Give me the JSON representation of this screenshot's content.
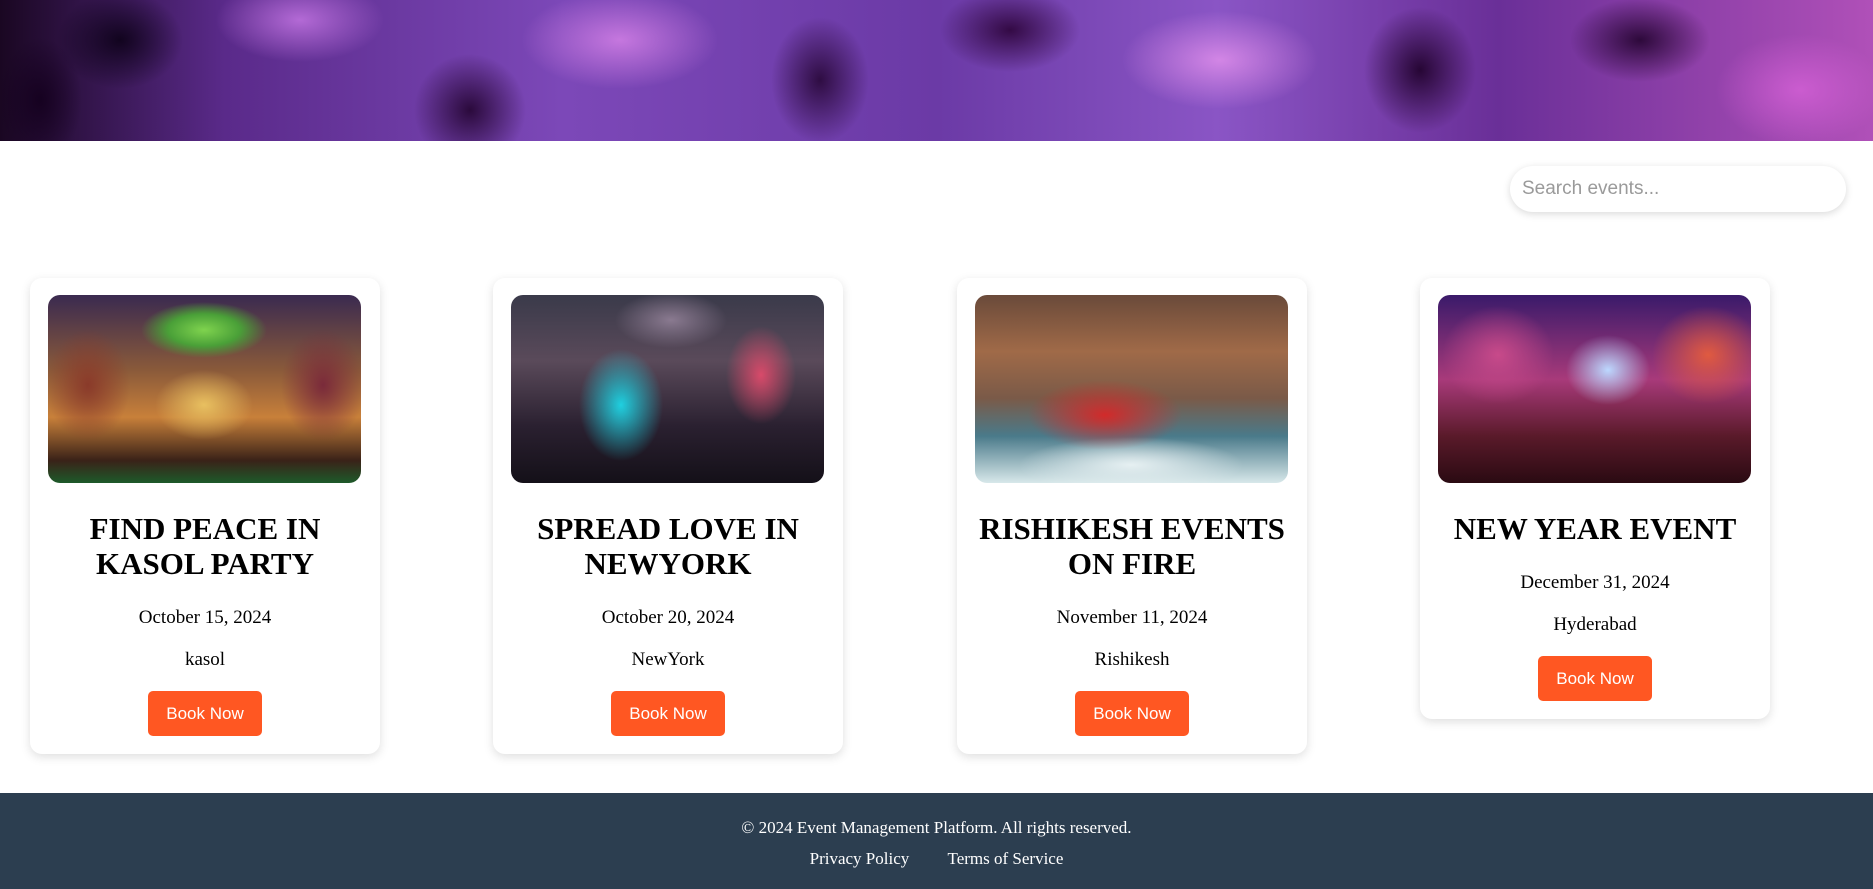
{
  "search": {
    "placeholder": "Search events..."
  },
  "events": [
    {
      "title": "FIND PEACE IN KASOL PARTY",
      "date": "October 15, 2024",
      "location": "kasol",
      "button_label": "Book Now"
    },
    {
      "title": "SPREAD LOVE IN NEWYORK",
      "date": "October 20, 2024",
      "location": "NewYork",
      "button_label": "Book Now"
    },
    {
      "title": "RISHIKESH EVENTS ON FIRE",
      "date": "November 11, 2024",
      "location": "Rishikesh",
      "button_label": "Book Now"
    },
    {
      "title": "NEW YEAR EVENT",
      "date": "December 31, 2024",
      "location": "Hyderabad",
      "button_label": "Book Now"
    }
  ],
  "footer": {
    "copyright": "© 2024 Event Management Platform. All rights reserved.",
    "links": [
      "Privacy Policy",
      "Terms of Service"
    ]
  },
  "colors": {
    "accent": "#ff5722",
    "footer_bg": "#2c3e50"
  }
}
